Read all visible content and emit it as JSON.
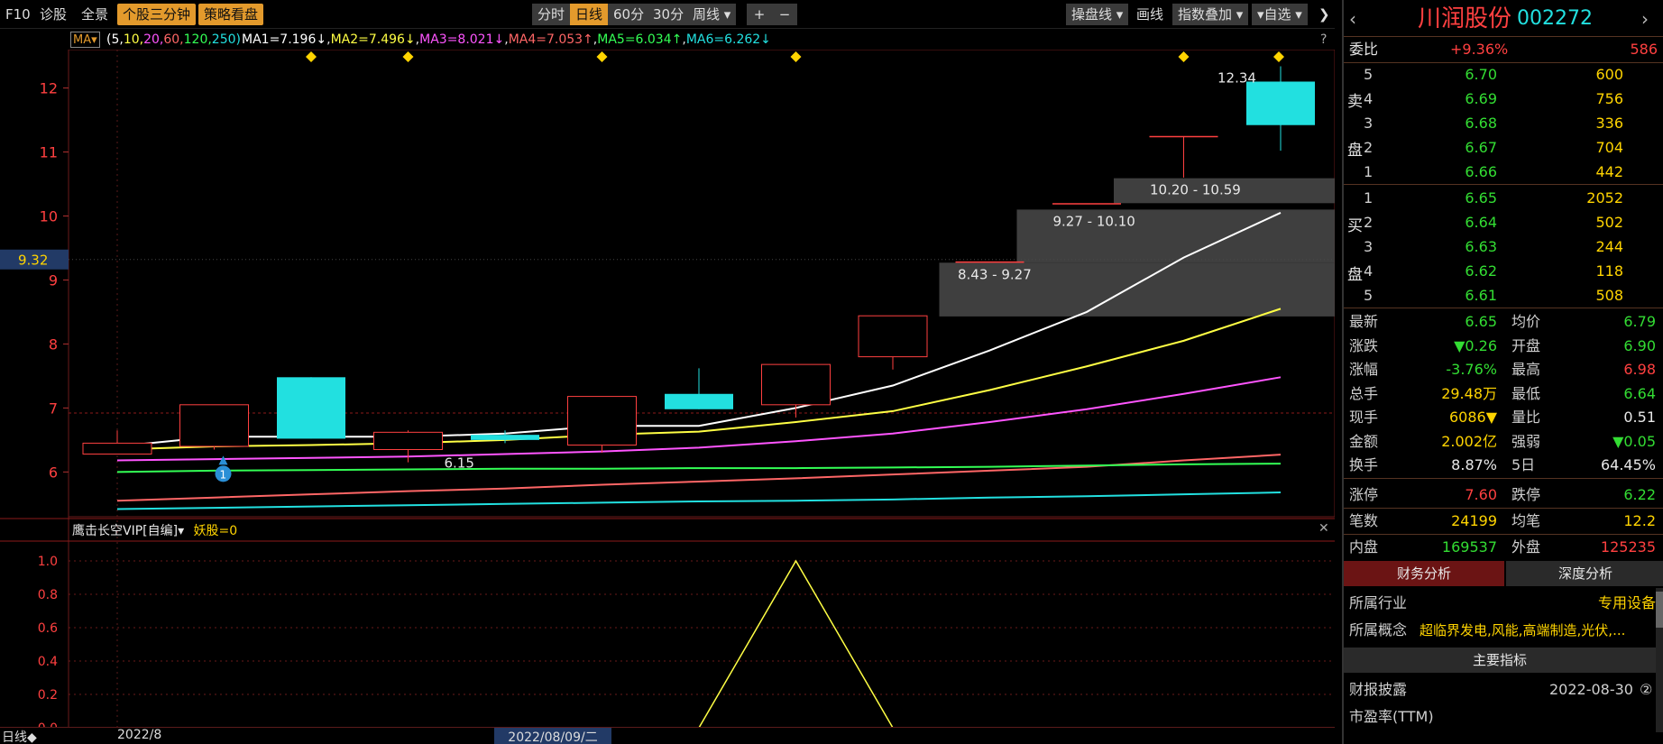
{
  "toolbar": {
    "f10": "F10",
    "diagnose": "诊股",
    "fullview": "全景",
    "three_min": "个股三分钟",
    "strategy": "策略看盘",
    "period_tabs": [
      "分时",
      "日线",
      "60分",
      "30分",
      "周线 ▾"
    ],
    "plus": "+",
    "minus": "−",
    "tools": [
      "操盘线 ▾",
      "画线",
      "指数叠加 ▾",
      "▾自选 ▾"
    ],
    "collapse": "❯"
  },
  "ma_legend": {
    "selector": "MA▾",
    "params": [
      "(5,",
      "10,",
      "20,",
      "60,",
      "120,",
      "250)"
    ],
    "items": [
      {
        "text": "MA1=7.196↓",
        "color": "#ffffff"
      },
      {
        "text": "MA2=7.496↓",
        "color": "#ffff44"
      },
      {
        "text": "MA3=8.021↓",
        "color": "#ff55ff"
      },
      {
        "text": "MA4=7.053↑",
        "color": "#ff6666"
      },
      {
        "text": "MA5=6.034↑",
        "color": "#33ff55"
      },
      {
        "text": "MA6=6.262↓",
        "color": "#22e0e0"
      }
    ],
    "help": "?"
  },
  "indicator": {
    "label": "鹰击长空VIP[自编]▾",
    "value": "妖股=0"
  },
  "bottom_bar": {
    "period": "日线◆",
    "month_label": "2022/8",
    "date_label": "2022/08/09/二"
  },
  "price_marker": "9.32",
  "colors": {
    "up": "#ff4040",
    "down": "#22e0e0",
    "grid": "#8b1a1a",
    "accent": "#e39a2c"
  },
  "chart_data": {
    "type": "candlestick",
    "ylim": [
      5.3,
      12.6
    ],
    "yticks": [
      6,
      7,
      8,
      9,
      10,
      11,
      12
    ],
    "candles": [
      {
        "open": 6.28,
        "close": 6.45,
        "high": 6.65,
        "low": 6.28
      },
      {
        "open": 6.4,
        "close": 7.05,
        "high": 7.05,
        "low": 6.35
      },
      {
        "open": 7.48,
        "close": 6.52,
        "high": 7.48,
        "low": 6.52
      },
      {
        "open": 6.35,
        "close": 6.62,
        "high": 6.65,
        "low": 6.15
      },
      {
        "open": 6.58,
        "close": 6.5,
        "high": 6.65,
        "low": 6.45
      },
      {
        "open": 6.42,
        "close": 7.18,
        "high": 7.18,
        "low": 6.3
      },
      {
        "open": 7.22,
        "close": 6.98,
        "high": 7.62,
        "low": 6.98
      },
      {
        "open": 7.05,
        "close": 7.68,
        "high": 7.68,
        "low": 6.85
      },
      {
        "open": 7.8,
        "close": 8.44,
        "high": 8.44,
        "low": 7.6
      },
      {
        "open": 9.28,
        "close": 9.28,
        "high": 9.28,
        "low": 9.28
      },
      {
        "open": 10.19,
        "close": 10.19,
        "high": 10.19,
        "low": 10.19
      },
      {
        "open": 11.24,
        "close": 11.24,
        "high": 11.24,
        "low": 10.6
      },
      {
        "open": 12.1,
        "close": 11.42,
        "high": 12.34,
        "low": 11.02
      }
    ],
    "ma_lines": [
      {
        "name": "MA1",
        "color": "#ffffff",
        "values": [
          6.4,
          6.55,
          6.55,
          6.55,
          6.6,
          6.72,
          6.72,
          7.0,
          7.35,
          7.9,
          8.5,
          9.35,
          10.05
        ]
      },
      {
        "name": "MA2",
        "color": "#ffff44",
        "values": [
          6.35,
          6.4,
          6.42,
          6.45,
          6.5,
          6.58,
          6.63,
          6.78,
          6.95,
          7.28,
          7.65,
          8.05,
          8.55
        ]
      },
      {
        "name": "MA3",
        "color": "#ff55ff",
        "values": [
          6.18,
          6.2,
          6.22,
          6.24,
          6.28,
          6.32,
          6.38,
          6.48,
          6.6,
          6.78,
          6.98,
          7.22,
          7.48
        ]
      },
      {
        "name": "MA4",
        "color": "#ff6666",
        "values": [
          5.55,
          5.6,
          5.65,
          5.7,
          5.74,
          5.8,
          5.85,
          5.9,
          5.96,
          6.02,
          6.08,
          6.18,
          6.27
        ]
      },
      {
        "name": "MA5",
        "color": "#33ff55",
        "values": [
          6.0,
          6.02,
          6.03,
          6.04,
          6.05,
          6.05,
          6.06,
          6.06,
          6.07,
          6.08,
          6.1,
          6.12,
          6.13
        ]
      },
      {
        "name": "MA6",
        "color": "#22e0e0",
        "values": [
          5.42,
          5.44,
          5.46,
          5.48,
          5.5,
          5.52,
          5.54,
          5.55,
          5.57,
          5.6,
          5.62,
          5.65,
          5.68
        ]
      }
    ],
    "annotations": [
      {
        "text": "6.15"
      },
      {
        "text": "8.43 - 9.27"
      },
      {
        "text": "9.27 - 10.10"
      },
      {
        "text": "10.20 - 10.59"
      },
      {
        "text": "12.34"
      }
    ],
    "indicator_ylim": [
      0,
      1
    ],
    "indicator_yticks": [
      "1.0",
      "0.8",
      "0.6",
      "0.4",
      "0.2",
      "0.0"
    ],
    "indicator_values": [
      0,
      0,
      0,
      0,
      0,
      0,
      0,
      1,
      0,
      0,
      0,
      0,
      0
    ]
  },
  "panel": {
    "stock_name": "川润股份",
    "stock_code": "002272",
    "ratio_label": "委比",
    "ratio_pct": "+9.36%",
    "ratio_val": "586",
    "sell_side_label": [
      "卖",
      "盘"
    ],
    "buy_side_label": [
      "买",
      "盘"
    ],
    "sells": [
      {
        "lvl": "5",
        "price": "6.70",
        "vol": "600"
      },
      {
        "lvl": "4",
        "price": "6.69",
        "vol": "756"
      },
      {
        "lvl": "3",
        "price": "6.68",
        "vol": "336"
      },
      {
        "lvl": "2",
        "price": "6.67",
        "vol": "704"
      },
      {
        "lvl": "1",
        "price": "6.66",
        "vol": "442"
      }
    ],
    "buys": [
      {
        "lvl": "1",
        "price": "6.65",
        "vol": "2052"
      },
      {
        "lvl": "2",
        "price": "6.64",
        "vol": "502"
      },
      {
        "lvl": "3",
        "price": "6.63",
        "vol": "244"
      },
      {
        "lvl": "4",
        "price": "6.62",
        "vol": "118"
      },
      {
        "lvl": "5",
        "price": "6.61",
        "vol": "508"
      }
    ],
    "stats": [
      {
        "l1": "最新",
        "v1": "6.65",
        "c1": "green",
        "l2": "均价",
        "v2": "6.79",
        "c2": "green"
      },
      {
        "l1": "涨跌",
        "v1": "▼0.26",
        "c1": "green",
        "l2": "开盘",
        "v2": "6.90",
        "c2": "green"
      },
      {
        "l1": "涨幅",
        "v1": "-3.76%",
        "c1": "green",
        "l2": "最高",
        "v2": "6.98",
        "c2": "red"
      },
      {
        "l1": "总手",
        "v1": "29.48万",
        "c1": "yellow",
        "l2": "最低",
        "v2": "6.64",
        "c2": "green"
      },
      {
        "l1": "现手",
        "v1": "6086▼",
        "c1": "yellow",
        "l2": "量比",
        "v2": "0.51",
        "c2": "white"
      },
      {
        "l1": "金额",
        "v1": "2.002亿",
        "c1": "yellow",
        "l2": "强弱",
        "v2": "▼0.05",
        "c2": "green"
      },
      {
        "l1": "换手",
        "v1": "8.87%",
        "c1": "white",
        "l2": "5日",
        "v2": "64.45%",
        "c2": "white"
      }
    ],
    "limits": {
      "up_label": "涨停",
      "up_val": "7.60",
      "down_label": "跌停",
      "down_val": "6.22"
    },
    "trades": {
      "l1": "笔数",
      "v1": "24199",
      "l2": "均笔",
      "v2": "12.2"
    },
    "inout": {
      "l1": "内盘",
      "v1": "169537",
      "l2": "外盘",
      "v2": "125235"
    },
    "tabs": [
      "财务分析",
      "深度分析"
    ],
    "industry_label": "所属行业",
    "industry_val": "专用设备",
    "concept_label": "所属概念",
    "concept_val": "超临界发电,风能,高端制造,光伏,...",
    "main_metrics": "主要指标",
    "report_label": "财报披露",
    "report_val": "2022-08-30",
    "report_badge": "②",
    "pe_label": "市盈率(TTM)"
  }
}
